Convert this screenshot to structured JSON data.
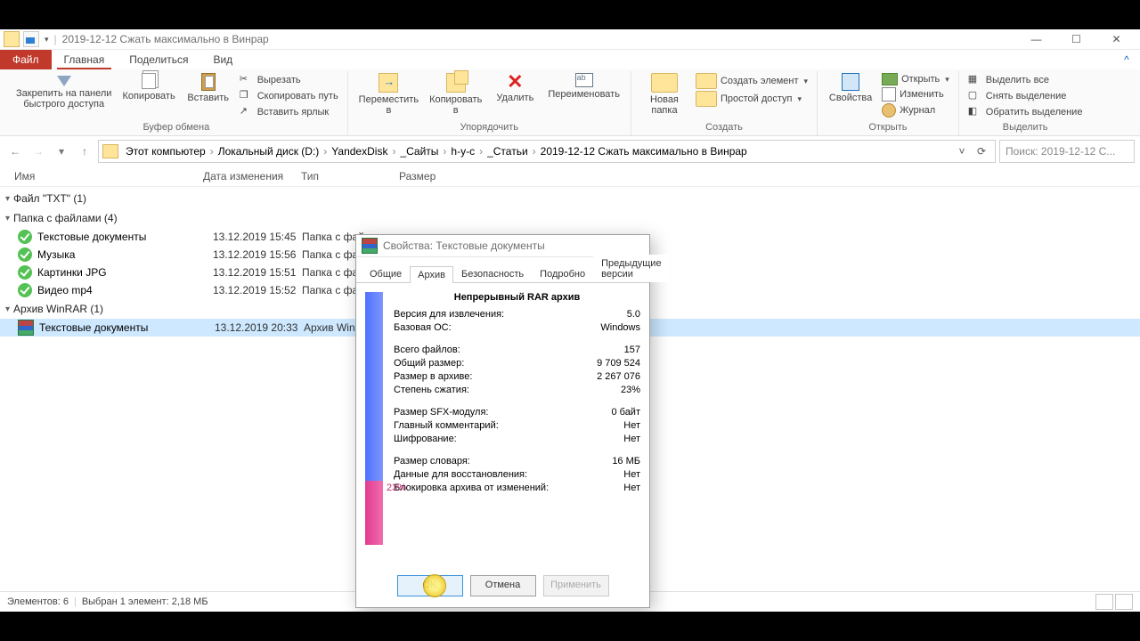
{
  "window": {
    "title": "2019-12-12 Сжать максимально в Винрар",
    "min": "—",
    "max": "☐",
    "close": "✕",
    "help": "^"
  },
  "tabs": {
    "file": "Файл",
    "home": "Главная",
    "share": "Поделиться",
    "view": "Вид"
  },
  "ribbon": {
    "pin": "Закрепить на панели\nбыстрого доступа",
    "copy": "Копировать",
    "paste": "Вставить",
    "cut": "Вырезать",
    "copypath": "Скопировать путь",
    "pastelnk": "Вставить ярлык",
    "move": "Переместить\nв",
    "copyto": "Копировать\nв",
    "delete": "Удалить",
    "rename": "Переименовать",
    "newfolder": "Новая\nпапка",
    "newitem": "Создать элемент",
    "easy": "Простой доступ",
    "props": "Свойства",
    "open": "Открыть",
    "edit": "Изменить",
    "journal": "Журнал",
    "selall": "Выделить все",
    "selnone": "Снять выделение",
    "selinv": "Обратить выделение",
    "g_clip": "Буфер обмена",
    "g_org": "Упорядочить",
    "g_new": "Создать",
    "g_open": "Открыть",
    "g_sel": "Выделить"
  },
  "crumbs": [
    "Этот компьютер",
    "Локальный диск (D:)",
    "YandexDisk",
    "_Сайты",
    "h-y-c",
    "_Статьи",
    "2019-12-12 Сжать максимально в Винрар"
  ],
  "search_ph": "Поиск: 2019-12-12 С...",
  "cols": {
    "name": "Имя",
    "date": "Дата изменения",
    "type": "Тип",
    "size": "Размер"
  },
  "groups": [
    {
      "title": "Файл \"TXT\" (1)",
      "items": []
    },
    {
      "title": "Папка с файлами (4)",
      "items": [
        {
          "icon": "green",
          "name": "Текстовые документы",
          "date": "13.12.2019 15:45",
          "type": "Папка с файлами"
        },
        {
          "icon": "green",
          "name": "Музыка",
          "date": "13.12.2019 15:56",
          "type": "Папка с файл"
        },
        {
          "icon": "green",
          "name": "Картинки JPG",
          "date": "13.12.2019 15:51",
          "type": "Папка с файл"
        },
        {
          "icon": "green",
          "name": "Видео mp4",
          "date": "13.12.2019 15:52",
          "type": "Папка с файл"
        }
      ]
    },
    {
      "title": "Архив WinRAR (1)",
      "items": [
        {
          "icon": "rar",
          "name": "Текстовые документы",
          "date": "13.12.2019 20:33",
          "type": "Архив WinRAR",
          "sel": true
        }
      ]
    }
  ],
  "status": {
    "count": "Элементов: 6",
    "sel": "Выбран 1 элемент: 2,18 МБ"
  },
  "dialog": {
    "title": "Свойства: Текстовые документы",
    "tabs": [
      "Общие",
      "Архив",
      "Безопасность",
      "Подробно",
      "Предыдущие версии"
    ],
    "active_tab": 1,
    "header": "Непрерывный RAR архив",
    "rows1": [
      {
        "k": "Версия для извлечения:",
        "v": "5.0"
      },
      {
        "k": "Базовая ОС:",
        "v": "Windows"
      }
    ],
    "rows2": [
      {
        "k": "Всего файлов:",
        "v": "157"
      },
      {
        "k": "Общий размер:",
        "v": "9 709 524"
      },
      {
        "k": "Размер в архиве:",
        "v": "2 267 076"
      },
      {
        "k": "Степень сжатия:",
        "v": "23%"
      }
    ],
    "rows3": [
      {
        "k": "Размер SFX-модуля:",
        "v": "0 байт"
      },
      {
        "k": "Главный комментарий:",
        "v": "Нет"
      },
      {
        "k": "Шифрование:",
        "v": "Нет"
      }
    ],
    "rows4": [
      {
        "k": "Размер словаря:",
        "v": "16 МБ"
      },
      {
        "k": "Данные для восстановления:",
        "v": "Нет"
      },
      {
        "k": "Блокировка архива от изменений:",
        "v": "Нет"
      }
    ],
    "barlabel": "23%",
    "ok": "OK",
    "cancel": "Отмена",
    "apply": "Применить"
  },
  "chart_data": {
    "type": "bar",
    "categories": [
      "Общий размер",
      "Размер в архиве"
    ],
    "values": [
      9709524,
      2267076
    ],
    "title": "Степень сжатия",
    "ratio_label": "23%"
  }
}
